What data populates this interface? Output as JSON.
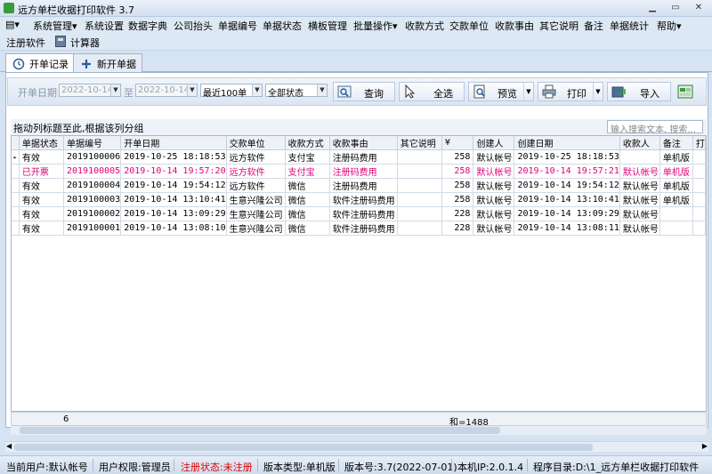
{
  "window": {
    "title": "远方单栏收据打印软件 3.7"
  },
  "menu": {
    "items": [
      "系统管理",
      "系统设置",
      "数据字典",
      "公司抬头",
      "单据编号",
      "单据状态",
      "横板管理",
      "批量操作",
      "收款方式",
      "交款单位",
      "收款事由",
      "其它说明",
      "备注",
      "单据统计",
      "帮助"
    ],
    "row2": [
      "注册软件",
      "计算器"
    ]
  },
  "tabs": [
    "开单记录",
    "新开单据"
  ],
  "toolbar": {
    "date_label": "开单日期",
    "date_from": "2022-10-14",
    "to_label": "至",
    "date_to": "2022-10-14",
    "count_filter": "最近100单",
    "status_filter": "全部状态",
    "query": "查询",
    "select_all": "全选",
    "preview": "预览",
    "print": "打印",
    "import": "导入"
  },
  "group_hint": "拖动列标题至此,根据该列分组",
  "search_placeholder": "输入搜索文本, 搜索...",
  "columns": [
    "单据状态",
    "单据编号",
    "开单日期",
    "交款单位",
    "收款方式",
    "收款事由",
    "其它说明",
    "¥",
    "创建人",
    "创建日期",
    "收款人",
    "备注",
    "打"
  ],
  "rows": [
    {
      "status": "有效",
      "no": "2019100006",
      "date": "2019-10-25 18:18:53",
      "payer": "远方软件",
      "method": "支付宝",
      "reason": "注册码费用",
      "other": "",
      "amount": "258",
      "creator": "默认帐号",
      "created": "2019-10-25 18:18:53",
      "receiver": "",
      "remark": "单机版",
      "highlight": false
    },
    {
      "status": "已开票",
      "no": "2019100005",
      "date": "2019-10-14 19:57:20",
      "payer": "远方软件",
      "method": "支付宝",
      "reason": "注册码费用",
      "other": "",
      "amount": "258",
      "creator": "默认帐号",
      "created": "2019-10-14 19:57:21",
      "receiver": "默认帐号",
      "remark": "单机版",
      "highlight": true
    },
    {
      "status": "有效",
      "no": "2019100004",
      "date": "2019-10-14 19:54:12",
      "payer": "远方软件",
      "method": "微信",
      "reason": "注册码费用",
      "other": "",
      "amount": "258",
      "creator": "默认帐号",
      "created": "2019-10-14 19:54:12",
      "receiver": "默认帐号",
      "remark": "单机版",
      "highlight": false
    },
    {
      "status": "有效",
      "no": "2019100003",
      "date": "2019-10-14 13:10:41",
      "payer": "生意兴隆公司",
      "method": "微信",
      "reason": "软件注册码费用",
      "other": "",
      "amount": "258",
      "creator": "默认帐号",
      "created": "2019-10-14 13:10:41",
      "receiver": "默认帐号",
      "remark": "单机版",
      "highlight": false
    },
    {
      "status": "有效",
      "no": "2019100002",
      "date": "2019-10-14 13:09:29",
      "payer": "生意兴隆公司",
      "method": "微信",
      "reason": "软件注册码费用",
      "other": "",
      "amount": "228",
      "creator": "默认帐号",
      "created": "2019-10-14 13:09:29",
      "receiver": "默认帐号",
      "remark": "",
      "highlight": false
    },
    {
      "status": "有效",
      "no": "2019100001",
      "date": "2019-10-14 13:08:10",
      "payer": "生意兴隆公司",
      "method": "微信",
      "reason": "软件注册码费用",
      "other": "",
      "amount": "228",
      "creator": "默认帐号",
      "created": "2019-10-14 13:08:11",
      "receiver": "默认帐号",
      "remark": "",
      "highlight": false
    }
  ],
  "footer": {
    "count": "6",
    "sum": "和=1488"
  },
  "status": {
    "user": "当前用户:默认帐号",
    "perm": "用户权限:管理员",
    "reg": "注册状态:未注册",
    "edition": "版本类型:单机版",
    "version": "版本号:3.7(2022-07-01)",
    "ip": "本机IP:2.0.1.4",
    "dir": "程序目录:D:\\1_远方单栏收据打印软件"
  },
  "colors": {
    "highlight_row": "#e0007a",
    "reg_status": "#e00000",
    "panel_bg": "#d6e3f2"
  }
}
